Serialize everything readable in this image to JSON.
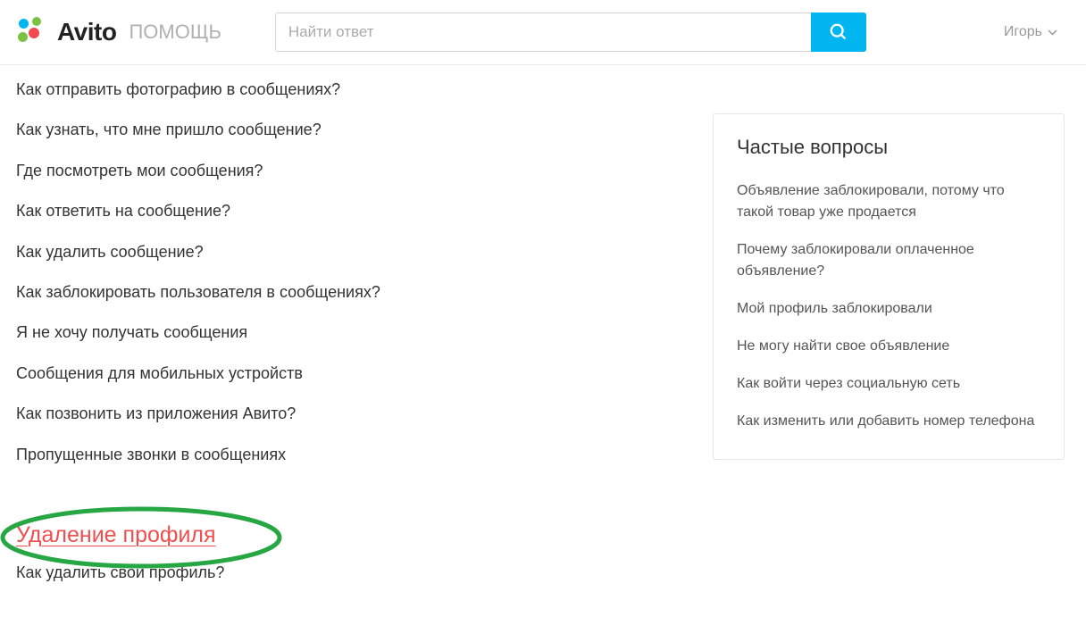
{
  "header": {
    "brand": "Avito",
    "brand_sub": "ПОМОЩЬ",
    "search_placeholder": "Найти ответ",
    "user_name": "Игорь"
  },
  "main": {
    "questions": [
      "Как отправить фотографию в сообщениях?",
      "Как узнать, что мне пришло сообщение?",
      "Где посмотреть мои сообщения?",
      "Как ответить на сообщение?",
      "Как удалить сообщение?",
      "Как заблокировать пользователя в сообщениях?",
      "Я не хочу получать сообщения",
      "Сообщения для мобильных устройств",
      "Как позвонить из приложения Авито?",
      "Пропущенные звонки в сообщениях"
    ],
    "section_title": "Удаление профиля",
    "section_questions": [
      "Как удалить свой профиль?"
    ]
  },
  "sidebar": {
    "faq_title": "Частые вопросы",
    "faq_items": [
      "Объявление заблокировали, потому что такой товар уже продается",
      "Почему заблокировали оплаченное объявление?",
      "Мой профиль заблокировали",
      "Не могу найти свое объявление",
      "Как войти через социальную сеть",
      "Как изменить или добавить номер телефона"
    ]
  }
}
